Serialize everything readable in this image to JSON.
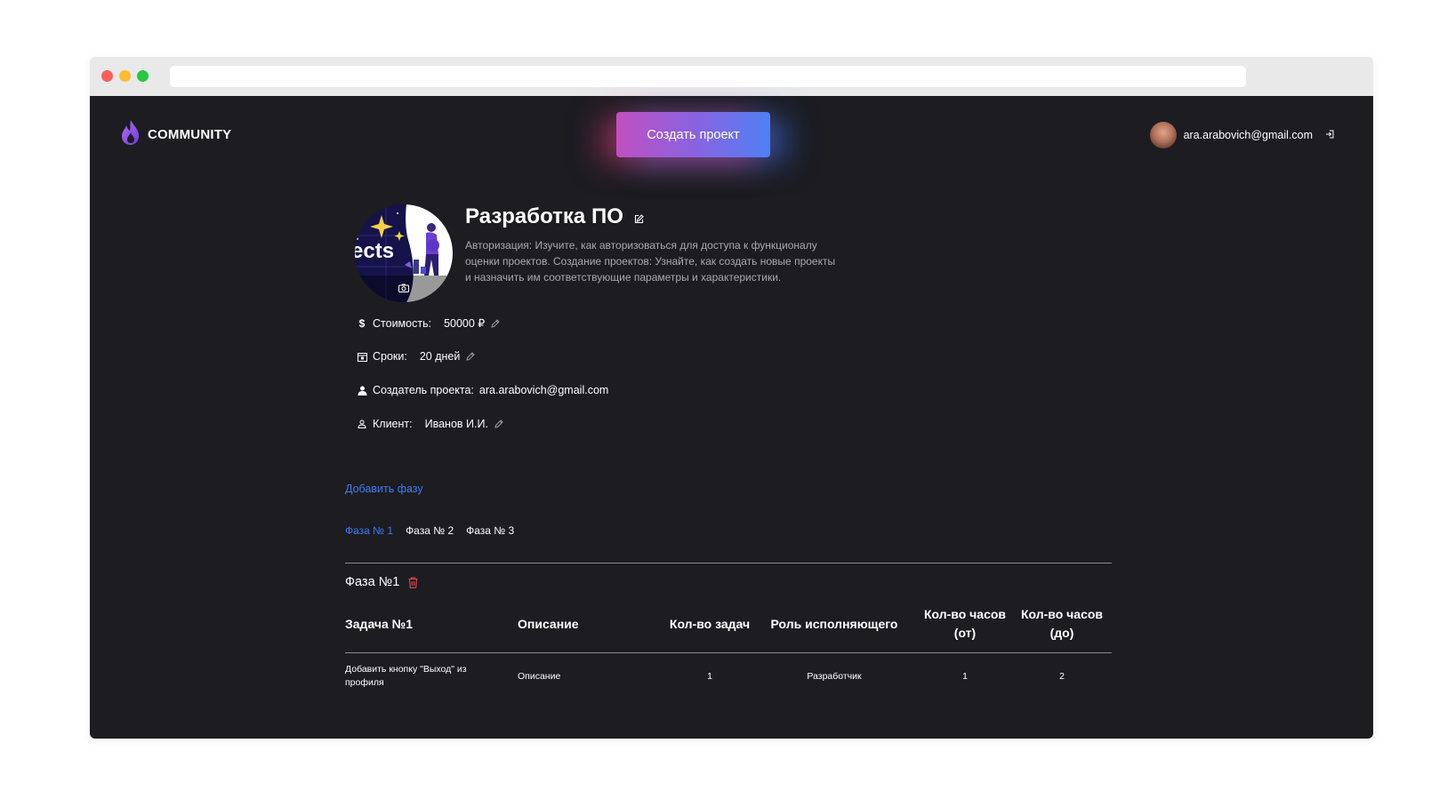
{
  "app": {
    "name": "COMMUNITY",
    "create_button": "Создать проект"
  },
  "user": {
    "email": "ara.arabovich@gmail.com"
  },
  "project": {
    "title": "Разработка ПО",
    "description": "Авторизация: Изучите, как авторизоваться для доступа к функционалу оценки проектов. Создание проектов: Узнайте, как создать новые проекты и назначить им соответствующие параметры и характеристики.",
    "image_text": "ects",
    "cost_label": "Стоимость:",
    "cost_value": "50000 ₽",
    "deadline_label": "Сроки:",
    "deadline_value": "20 дней",
    "creator_label": "Создатель проекта:",
    "creator_value": "ara.arabovich@gmail.com",
    "client_label": "Клиент:",
    "client_value": "Иванов И.И."
  },
  "phases": {
    "add_label": "Добавить фазу",
    "tabs": [
      "Фаза № 1",
      "Фаза № 2",
      "Фаза № 3"
    ],
    "current_title": "Фаза №1"
  },
  "table": {
    "headers": [
      "Задача №1",
      "Описание",
      "Кол-во задач",
      "Роль исполняющего",
      "Кол-во часов (от)",
      "Кол-во часов (до)"
    ],
    "rows": [
      [
        "Добавить кнопку \"Выход\" из профиля",
        "Описание",
        "1",
        "Разработчик",
        "1",
        "2"
      ]
    ]
  },
  "colors": {
    "background": "#1c1c21",
    "accent": "#3d7cf2",
    "danger": "#e0484d"
  },
  "icons": [
    "flame-logo-icon",
    "logout-icon",
    "edit-icon",
    "camera-icon",
    "dollar-icon",
    "calendar-icon",
    "user-icon",
    "client-icon",
    "pencil-icon",
    "trash-icon"
  ]
}
